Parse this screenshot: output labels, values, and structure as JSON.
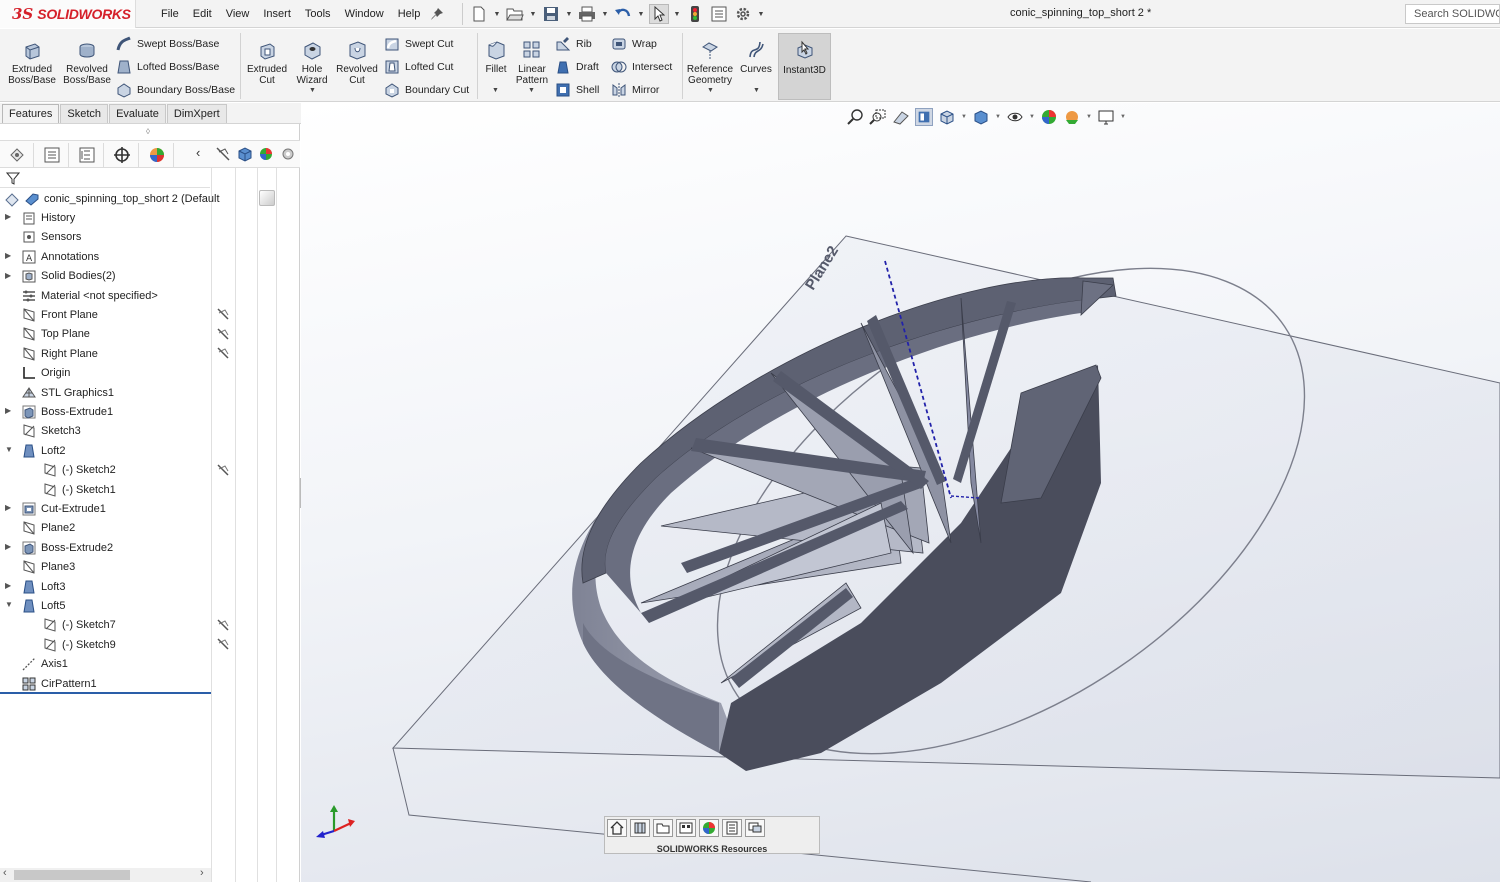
{
  "app": {
    "brand_prefix": "3S",
    "brand_name": "SOLIDWORKS",
    "document_title": "conic_spinning_top_short 2 *"
  },
  "menu": [
    "File",
    "Edit",
    "View",
    "Insert",
    "Tools",
    "Window",
    "Help"
  ],
  "search": {
    "placeholder": "Search SOLIDWORKS"
  },
  "ribbon": {
    "extruded_boss": [
      "Extruded",
      "Boss/Base"
    ],
    "revolved_boss": [
      "Revolved",
      "Boss/Base"
    ],
    "swept_boss": "Swept Boss/Base",
    "lofted_boss": "Lofted Boss/Base",
    "boundary_boss": "Boundary Boss/Base",
    "extruded_cut": [
      "Extruded",
      "Cut"
    ],
    "hole_wizard": [
      "Hole",
      "Wizard"
    ],
    "revolved_cut": [
      "Revolved",
      "Cut"
    ],
    "swept_cut": "Swept Cut",
    "lofted_cut": "Lofted Cut",
    "boundary_cut": "Boundary Cut",
    "fillet": "Fillet",
    "linear_pattern": [
      "Linear",
      "Pattern"
    ],
    "rib": "Rib",
    "draft": "Draft",
    "shell": "Shell",
    "wrap": "Wrap",
    "intersect": "Intersect",
    "mirror": "Mirror",
    "reference_geometry": [
      "Reference",
      "Geometry"
    ],
    "curves": "Curves",
    "instant3d": "Instant3D"
  },
  "tabs": [
    {
      "label": "Features",
      "active": true
    },
    {
      "label": "Sketch",
      "active": false
    },
    {
      "label": "Evaluate",
      "active": false
    },
    {
      "label": "DimXpert",
      "active": false
    }
  ],
  "tree": {
    "root": "conic_spinning_top_short 2  (Default",
    "items": [
      {
        "label": "History",
        "icon": "history-icon",
        "expand": true,
        "indent": 0,
        "hidden_mark": false
      },
      {
        "label": "Sensors",
        "icon": "sensors-icon",
        "expand": false,
        "indent": 0,
        "hidden_mark": false
      },
      {
        "label": "Annotations",
        "icon": "annotations-icon",
        "expand": true,
        "indent": 0,
        "hidden_mark": false
      },
      {
        "label": "Solid Bodies(2)",
        "icon": "solid-bodies-icon",
        "expand": true,
        "indent": 0,
        "hidden_mark": false
      },
      {
        "label": "Material <not specified>",
        "icon": "material-icon",
        "expand": false,
        "indent": 0,
        "hidden_mark": false
      },
      {
        "label": "Front Plane",
        "icon": "plane-icon",
        "expand": false,
        "indent": 0,
        "hidden_mark": true
      },
      {
        "label": "Top Plane",
        "icon": "plane-icon",
        "expand": false,
        "indent": 0,
        "hidden_mark": true
      },
      {
        "label": "Right Plane",
        "icon": "plane-icon",
        "expand": false,
        "indent": 0,
        "hidden_mark": true
      },
      {
        "label": "Origin",
        "icon": "origin-icon",
        "expand": false,
        "indent": 0,
        "hidden_mark": false
      },
      {
        "label": "STL Graphics1",
        "icon": "stl-graphics-icon",
        "expand": false,
        "indent": 0,
        "hidden_mark": false
      },
      {
        "label": "Boss-Extrude1",
        "icon": "extrude-icon",
        "expand": true,
        "indent": 0,
        "hidden_mark": false
      },
      {
        "label": "Sketch3",
        "icon": "sketch-icon",
        "expand": false,
        "indent": 0,
        "hidden_mark": false
      },
      {
        "label": "Loft2",
        "icon": "loft-icon",
        "expand": "open",
        "indent": 0,
        "hidden_mark": false
      },
      {
        "label": "(-) Sketch2",
        "icon": "sketch-icon",
        "expand": false,
        "indent": 1,
        "hidden_mark": true
      },
      {
        "label": "(-) Sketch1",
        "icon": "sketch-icon",
        "expand": false,
        "indent": 1,
        "hidden_mark": false
      },
      {
        "label": "Cut-Extrude1",
        "icon": "cut-extrude-icon",
        "expand": true,
        "indent": 0,
        "hidden_mark": false
      },
      {
        "label": "Plane2",
        "icon": "plane-icon",
        "expand": false,
        "indent": 0,
        "hidden_mark": false
      },
      {
        "label": "Boss-Extrude2",
        "icon": "extrude-icon",
        "expand": true,
        "indent": 0,
        "hidden_mark": false
      },
      {
        "label": "Plane3",
        "icon": "plane-icon",
        "expand": false,
        "indent": 0,
        "hidden_mark": false
      },
      {
        "label": "Loft3",
        "icon": "loft-icon",
        "expand": true,
        "indent": 0,
        "hidden_mark": false
      },
      {
        "label": "Loft5",
        "icon": "loft-icon",
        "expand": "open",
        "indent": 0,
        "hidden_mark": false
      },
      {
        "label": "(-) Sketch7",
        "icon": "sketch-icon",
        "expand": false,
        "indent": 1,
        "hidden_mark": true
      },
      {
        "label": "(-) Sketch9",
        "icon": "sketch-icon",
        "expand": false,
        "indent": 1,
        "hidden_mark": true
      },
      {
        "label": "Axis1",
        "icon": "axis-icon",
        "expand": false,
        "indent": 0,
        "hidden_mark": false
      },
      {
        "label": "CirPattern1",
        "icon": "circular-pattern-icon",
        "expand": false,
        "indent": 0,
        "hidden_mark": false
      }
    ]
  },
  "viewport": {
    "plane_label": "Plane2"
  },
  "taskpane": {
    "label": "SOLIDWORKS Resources"
  },
  "colors": {
    "accent": "#d5202a",
    "tree_rule": "#2a5ea8",
    "model_face": "#5b5f6e",
    "model_light": "#9296a6"
  }
}
